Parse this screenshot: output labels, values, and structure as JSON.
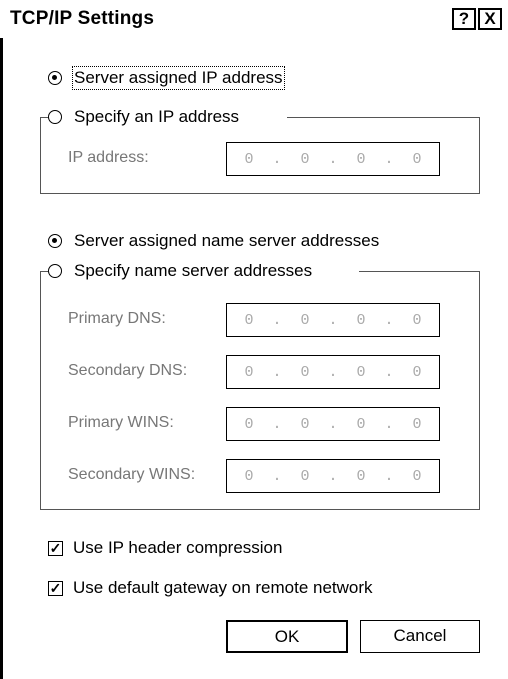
{
  "dialog": {
    "title": "TCP/IP Settings",
    "help_button": "?",
    "close_button": "X"
  },
  "ip": {
    "server_assigned_label": "Server assigned IP address",
    "specify_label": "Specify an IP address",
    "address_label": "IP address:",
    "address_value": [
      "0",
      "0",
      "0",
      "0"
    ]
  },
  "dns": {
    "server_assigned_label": "Server assigned name server addresses",
    "specify_label": "Specify name server addresses",
    "fields": [
      {
        "label": "Primary DNS:",
        "value": [
          "0",
          "0",
          "0",
          "0"
        ]
      },
      {
        "label": "Secondary DNS:",
        "value": [
          "0",
          "0",
          "0",
          "0"
        ]
      },
      {
        "label": "Primary WINS:",
        "value": [
          "0",
          "0",
          "0",
          "0"
        ]
      },
      {
        "label": "Secondary WINS:",
        "value": [
          "0",
          "0",
          "0",
          "0"
        ]
      }
    ]
  },
  "options": {
    "compression_label": "Use IP header compression",
    "gateway_label": "Use default gateway on remote network"
  },
  "buttons": {
    "ok": "OK",
    "cancel": "Cancel"
  }
}
